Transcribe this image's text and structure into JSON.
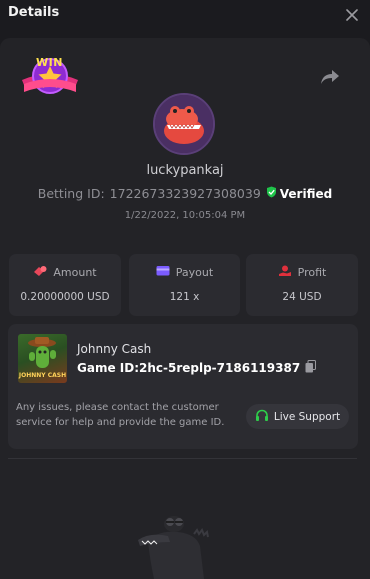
{
  "header": {
    "title": "Details"
  },
  "player": {
    "username": "luckypankaj",
    "betting_id_label": "Betting ID:",
    "betting_id": "1722673323927308039",
    "verified_label": "Verified",
    "timestamp": "1/22/2022, 10:05:04 PM"
  },
  "stats": [
    {
      "label": "Amount",
      "value": "0.20000000 USD",
      "icon": "coins-icon"
    },
    {
      "label": "Payout",
      "value": "121 x",
      "icon": "wallet-icon"
    },
    {
      "label": "Profit",
      "value": "24 USD",
      "icon": "profit-hand-icon"
    }
  ],
  "game": {
    "name": "Johnny Cash",
    "thumb_label": "JOHNNY CASH",
    "id_label": "Game ID:",
    "id": "2hc-5replp-7186119387"
  },
  "help_text": "Any issues, please contact the customer service for help and provide the game ID.",
  "support": {
    "label": "Live Support"
  },
  "badge": {
    "text": "WIN"
  },
  "colors": {
    "background": "#1b1b1f",
    "panel": "#232327",
    "card": "#2b2b30",
    "verified_green": "#1fc34a",
    "amount_icon": "#e8475a",
    "payout_icon": "#7b5cff",
    "profit_icon": "#e0303c"
  }
}
